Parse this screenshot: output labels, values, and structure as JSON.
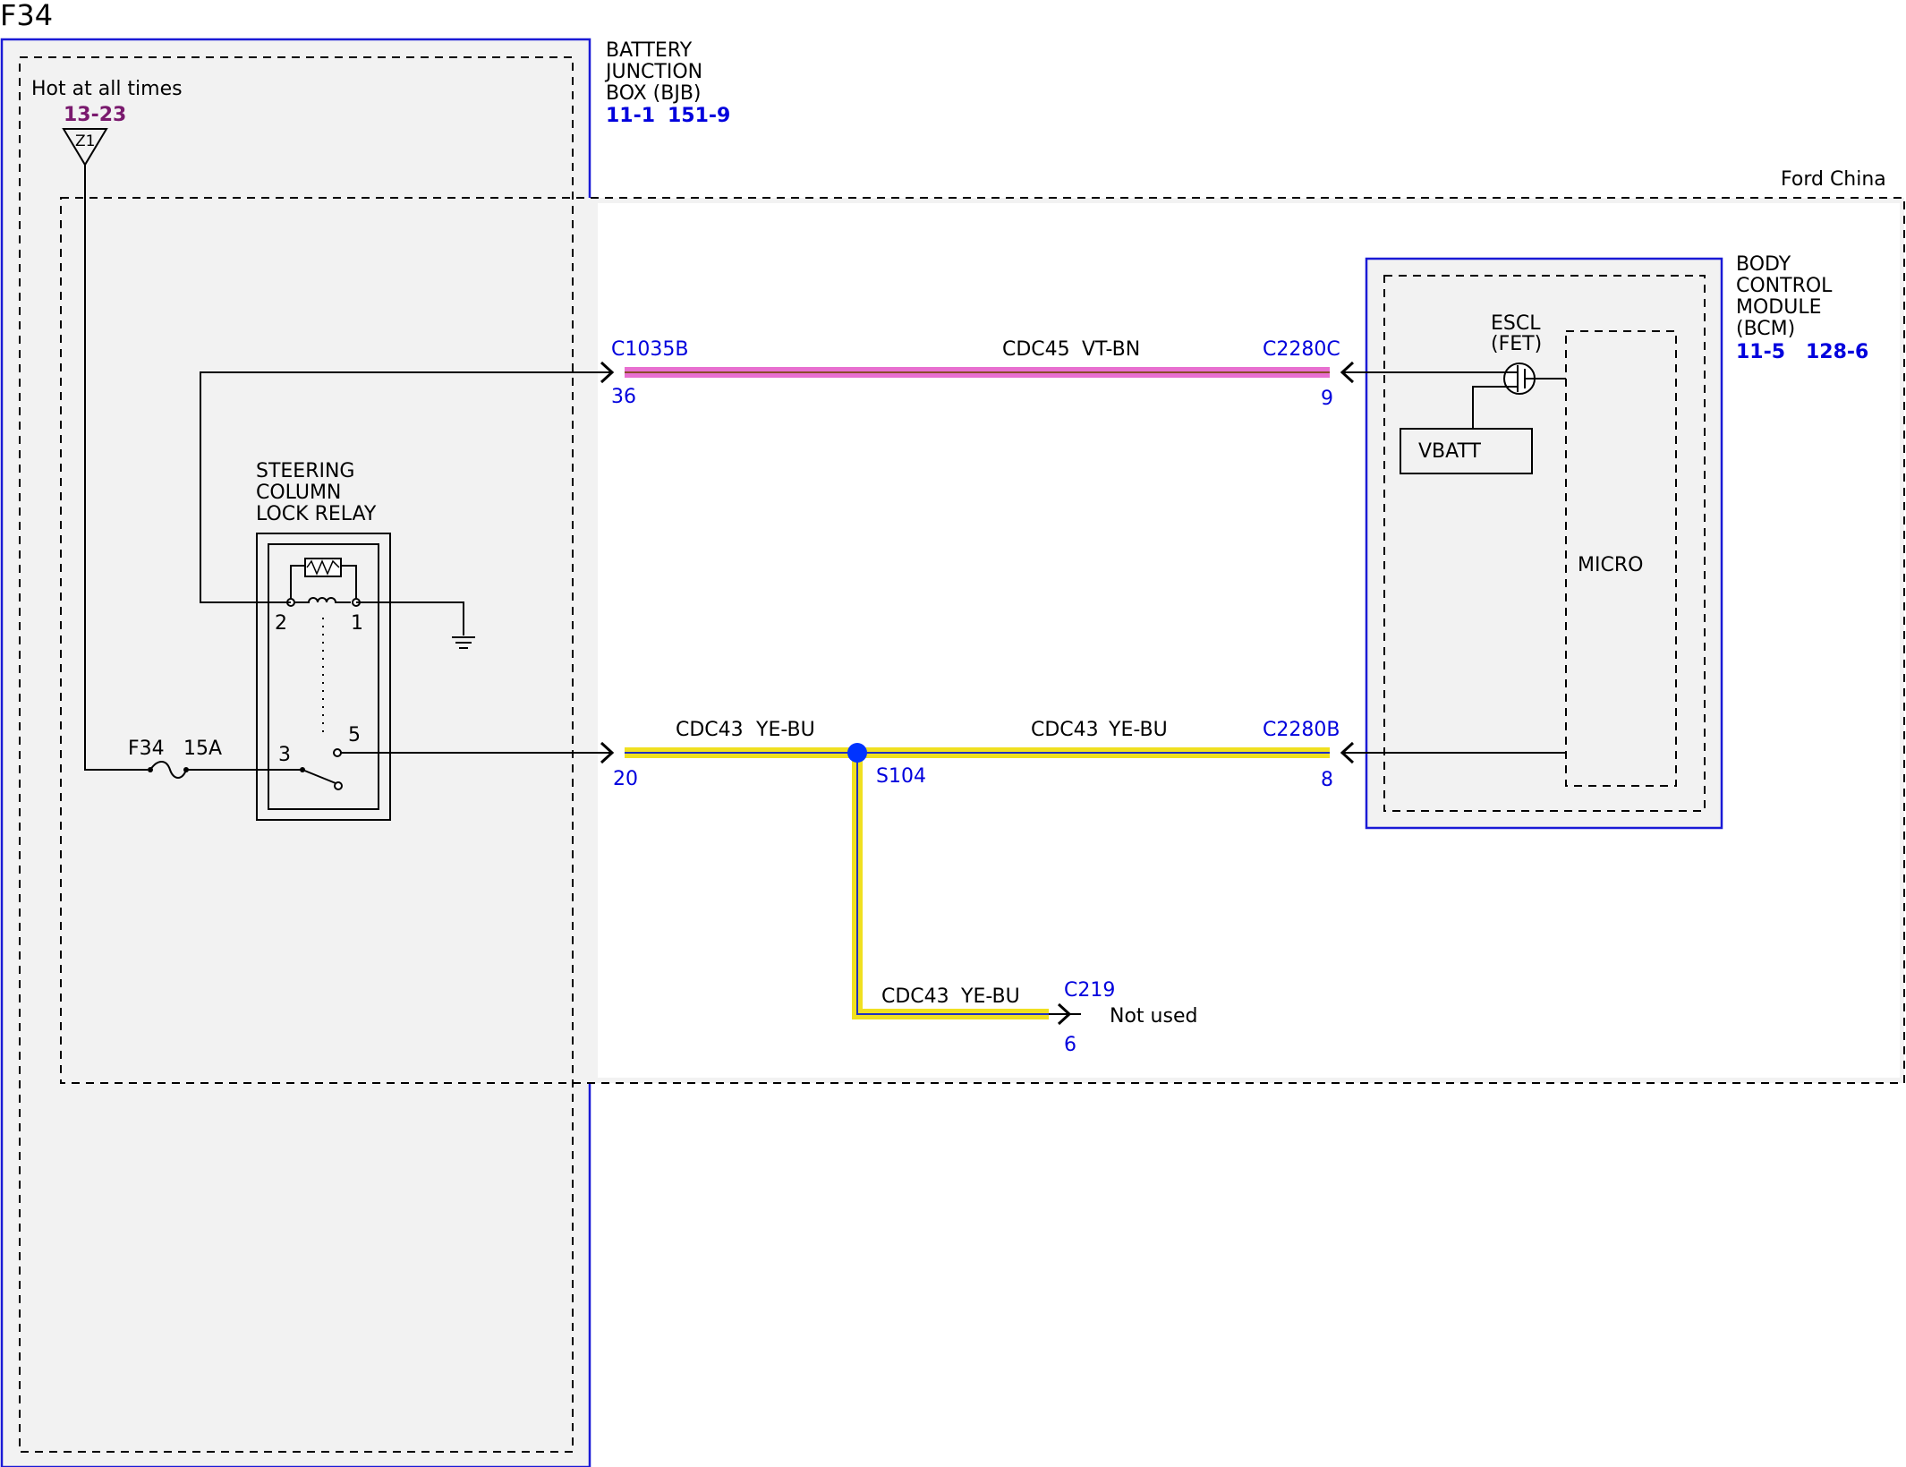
{
  "page_label": "F34",
  "colors": {
    "border_blue": "#1a1ad6",
    "ref_blue": "#0000dd",
    "ref_purple": "#7a1a6e",
    "panel_fill": "#f2f2f2",
    "wire_pink": "#e86fd0",
    "wire_yellow": "#f0e020",
    "wire_blue": "#2030c0",
    "splice_blue": "#0033ff"
  },
  "bjb": {
    "name_lines": [
      "BATTERY",
      "JUNCTION",
      "BOX (BJB)"
    ],
    "refs": [
      "11-1",
      "151-9"
    ],
    "hot_label": "Hot at all times",
    "hot_ref": "13-23",
    "feed_id": "Z1"
  },
  "region_label": "Ford China",
  "relay": {
    "name_lines": [
      "STEERING",
      "COLUMN",
      "LOCK RELAY"
    ],
    "pins": [
      "2",
      "1",
      "3",
      "5"
    ],
    "fuse_label": "F34",
    "fuse_rating": "15A"
  },
  "wires": {
    "top": {
      "circuit": "CDC45",
      "color": "VT-BN",
      "left_connector": "C1035B",
      "left_pin": "36",
      "right_connector": "C2280C",
      "right_pin": "9"
    },
    "bottom_left": {
      "circuit": "CDC43",
      "color": "YE-BU",
      "connector": "",
      "pin": "20"
    },
    "bottom_right": {
      "circuit": "CDC43",
      "color": "YE-BU",
      "connector": "C2280B",
      "pin": "8"
    },
    "branch": {
      "circuit": "CDC43",
      "color": "YE-BU",
      "connector": "C219",
      "pin": "6",
      "note": "Not used"
    },
    "splice": "S104"
  },
  "bcm": {
    "name_lines": [
      "BODY",
      "CONTROL",
      "MODULE",
      "(BCM)"
    ],
    "refs": [
      "11-5",
      "128-6"
    ],
    "escl_lines": [
      "ESCL",
      "(FET)"
    ],
    "vbatt": "VBATT",
    "micro": "MICRO"
  }
}
